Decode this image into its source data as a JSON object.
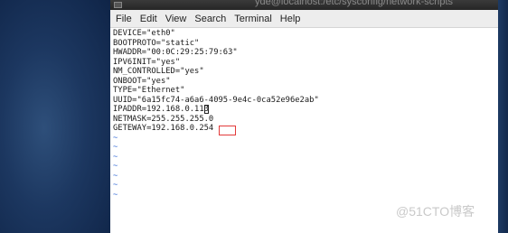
{
  "window": {
    "title": "yde@localhost:/etc/sysconfig/network-scripts"
  },
  "menu": {
    "items": [
      "File",
      "Edit",
      "View",
      "Search",
      "Terminal",
      "Help"
    ]
  },
  "terminal": {
    "lines": [
      "DEVICE=\"eth0\"",
      "BOOTPROTO=\"static\"",
      "HWADDR=\"00:0C:29:25:79:63\"",
      "IPV6INIT=\"yes\"",
      "NM_CONTROLLED=\"yes\"",
      "ONBOOT=\"yes\"",
      "TYPE=\"Ethernet\"",
      "UUID=\"6a15fc74-a6a6-4095-9e4c-0ca52e96e2ab\"",
      "IPADDR=192.168.0.11",
      "NETMASK=255.255.255.0",
      "GETEWAY=192.168.0.254"
    ],
    "cursor_char": "3",
    "tilde_lines": [
      "~",
      "~",
      "~",
      "~",
      "~",
      "~",
      "~"
    ]
  },
  "watermark": "@51CTO博客",
  "colors": {
    "desktop": "#1c3760",
    "titlebar": "#2e2e2e",
    "menubar": "#ededed",
    "tilde": "#3a6fd8",
    "highlight_box": "#e23a3a"
  }
}
